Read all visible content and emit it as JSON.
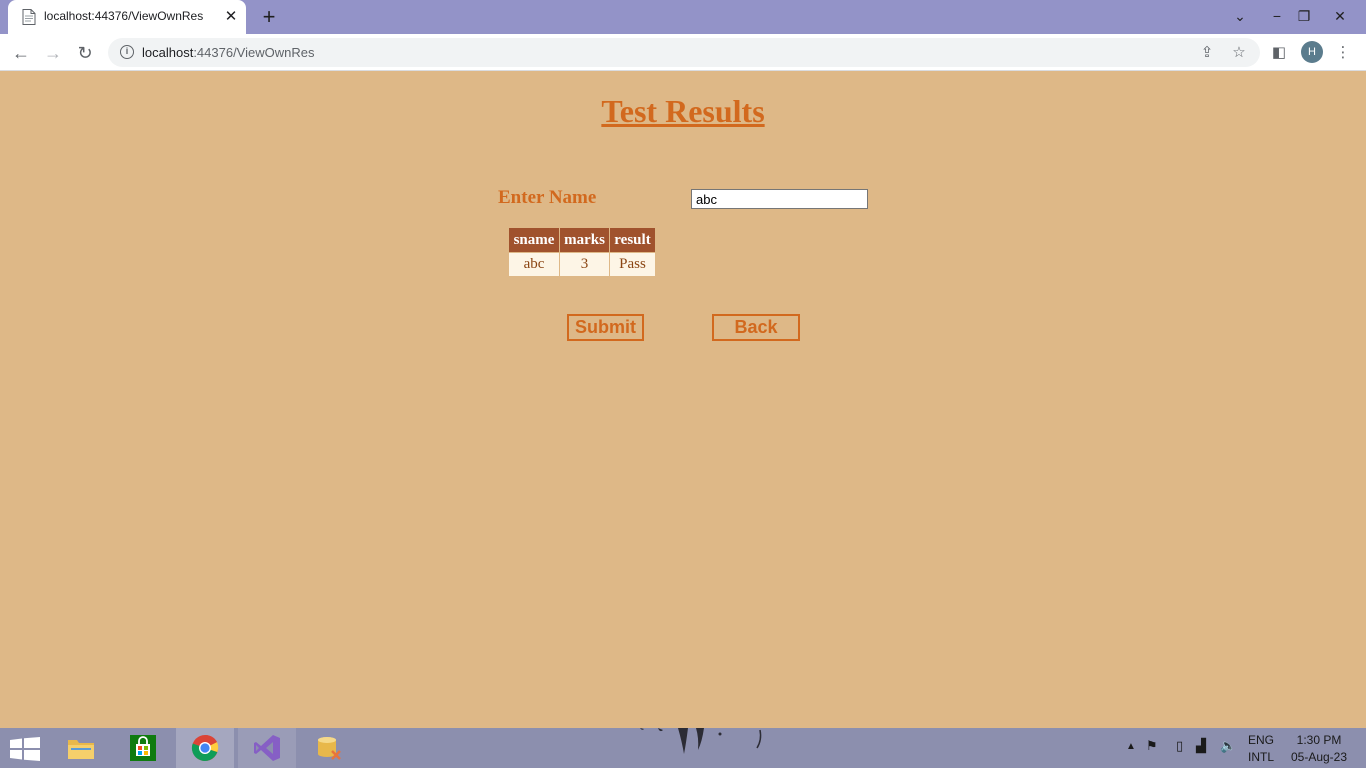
{
  "browser": {
    "tab_title": "localhost:44376/ViewOwnRes",
    "url_host": "localhost",
    "url_rest": ":44376/ViewOwnRes",
    "profile_initial": "H"
  },
  "page": {
    "title": "Test Results",
    "name_label": "Enter Name",
    "name_value": "abc",
    "table": {
      "headers": [
        "sname",
        "marks",
        "result"
      ],
      "rows": [
        [
          "abc",
          "3",
          "Pass"
        ]
      ]
    },
    "submit_label": "Submit",
    "back_label": "Back"
  },
  "taskbar": {
    "language": "ENG",
    "layout": "INTL",
    "time": "1:30 PM",
    "date": "05-Aug-23"
  },
  "colors": {
    "page_background": "#deb887",
    "accent": "#d2691e",
    "table_header": "#a0522d",
    "table_cell": "#fdf5e6",
    "titlebar": "#9393c8",
    "taskbar": "#8c8fae"
  }
}
